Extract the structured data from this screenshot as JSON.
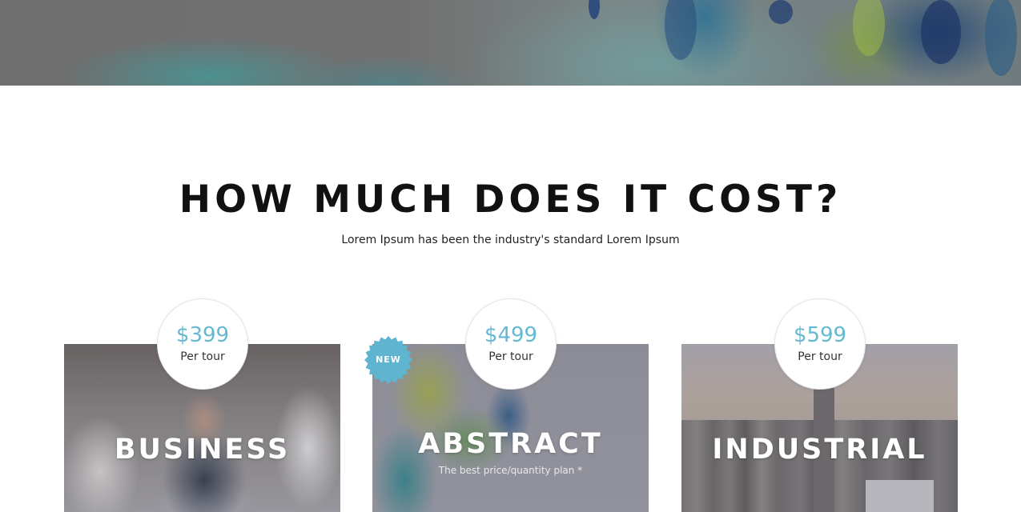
{
  "section": {
    "title": "HOW MUCH DOES IT COST?",
    "subtitle": "Lorem Ipsum has been the industry's standard Lorem Ipsum"
  },
  "colors": {
    "accent": "#64b9d2",
    "badge": "#5fb4cf",
    "title": "#111111"
  },
  "plans": [
    {
      "name": "BUSINESS",
      "price": "$399",
      "period": "Per tour",
      "tagline": "",
      "badge": ""
    },
    {
      "name": "ABSTRACT",
      "price": "$499",
      "period": "Per tour",
      "tagline": "The best price/quantity plan *",
      "badge": "NEW"
    },
    {
      "name": "INDUSTRIAL",
      "price": "$599",
      "period": "Per tour",
      "tagline": "",
      "badge": ""
    }
  ]
}
